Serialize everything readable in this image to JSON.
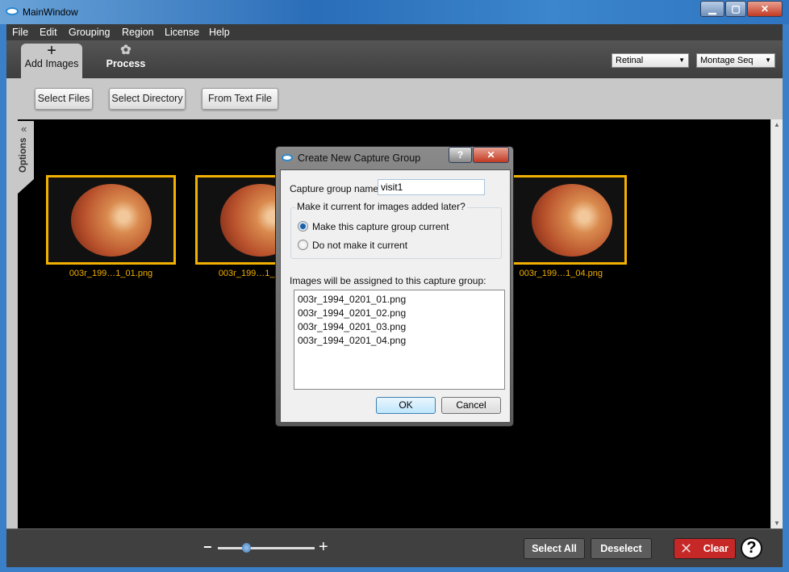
{
  "window": {
    "title": "MainWindow",
    "minimize": "▁",
    "maximize": "▢",
    "close": "✕"
  },
  "menu": [
    "File",
    "Edit",
    "Grouping",
    "Region",
    "License",
    "Help"
  ],
  "tabs": [
    {
      "label": "Add Images",
      "icon": "plus-icon",
      "active": true
    },
    {
      "label": "Process",
      "icon": "gear-icon",
      "active": false
    }
  ],
  "combos": {
    "modality": "Retinal",
    "mode": "Montage Seq"
  },
  "toolbar": {
    "select_files": "Select Files",
    "select_directory": "Select Directory",
    "from_text_file": "From Text File"
  },
  "options_label": "Options",
  "options_collapse": "«",
  "thumbnails": [
    {
      "label": "003r_199…1_01.png"
    },
    {
      "label": "003r_199…1_02.png"
    },
    {
      "label": "003r_199…1_04.png"
    }
  ],
  "bottom": {
    "zoom_minus": "−",
    "zoom_plus": "+",
    "zoom_level": 0.3,
    "select_all": "Select All",
    "deselect": "Deselect",
    "clear": "Clear",
    "help": "?"
  },
  "dialog": {
    "title": "Create New Capture Group",
    "help": "?",
    "close": "✕",
    "name_label": "Capture group name:",
    "name_value": "visit1",
    "group_title": "Make it current for images added later?",
    "radio_current": "Make this capture group current",
    "radio_not_current": "Do not make it current",
    "selected": "current",
    "list_label": "Images will be assigned to this capture group:",
    "images": [
      "003r_1994_0201_01.png",
      "003r_1994_0201_02.png",
      "003r_1994_0201_03.png",
      "003r_1994_0201_04.png"
    ],
    "ok": "OK",
    "cancel": "Cancel"
  },
  "colors": {
    "selection": "#f2b000",
    "clear": "#c62828",
    "titlebar": "#2a6db8"
  }
}
